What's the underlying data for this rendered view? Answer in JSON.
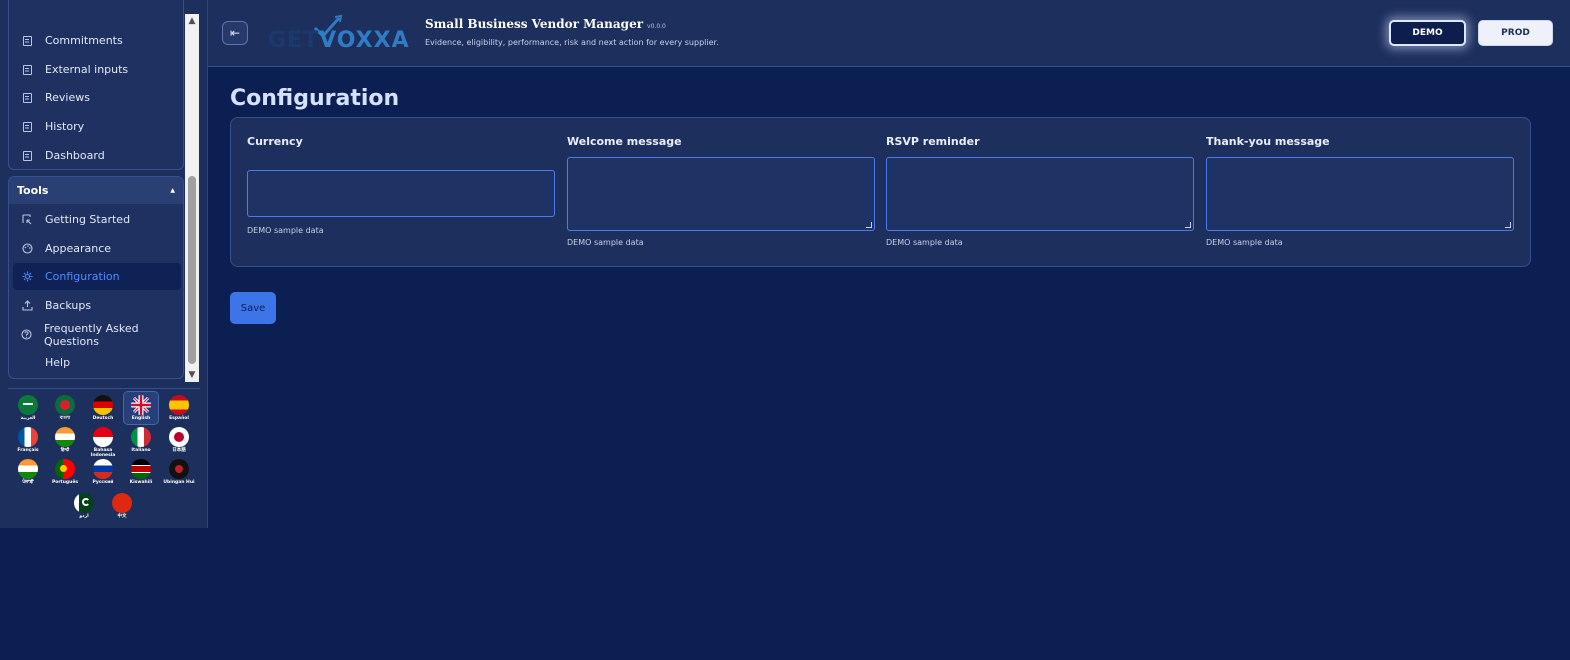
{
  "sidebar": {
    "items_top": [
      {
        "label": "Commitments"
      },
      {
        "label": "External inputs"
      },
      {
        "label": "Reviews"
      },
      {
        "label": "History"
      },
      {
        "label": "Dashboard"
      }
    ],
    "tools": {
      "title": "Tools",
      "chevron": "▲",
      "items": [
        {
          "label": "Getting Started",
          "icon": "getting-started-icon"
        },
        {
          "label": "Appearance",
          "icon": "palette-icon"
        },
        {
          "label": "Configuration",
          "icon": "gear-icon",
          "active": true
        },
        {
          "label": "Backups",
          "icon": "upload-icon"
        },
        {
          "label": "Frequently Asked Questions",
          "icon": "help-circle-icon"
        },
        {
          "label": "Help",
          "icon": ""
        }
      ]
    },
    "languages": [
      {
        "label": "العربية"
      },
      {
        "label": "বাংলা"
      },
      {
        "label": "Deutsch"
      },
      {
        "label": "English",
        "selected": true
      },
      {
        "label": "Español"
      },
      {
        "label": "Français"
      },
      {
        "label": "हिन्दी"
      },
      {
        "label": "Bahasa Indonesia"
      },
      {
        "label": "Italiano"
      },
      {
        "label": "日本語"
      },
      {
        "label": "ਪੰਜਾਬੀ"
      },
      {
        "label": "Português"
      },
      {
        "label": "Русский"
      },
      {
        "label": "Kiswahili"
      },
      {
        "label": "Ubingan Hui"
      },
      {
        "label": "اردو"
      },
      {
        "label": "中文"
      }
    ]
  },
  "header": {
    "toggle_icon": "⇤",
    "logo_get": "GET",
    "logo_voxxa": "VOXXA",
    "title": "Small Business Vendor Manager",
    "version": "v0.0.0",
    "subtitle": "Evidence, eligibility, performance, risk and next action for every supplier.",
    "demo_label": "DEMO",
    "prod_label": "PROD"
  },
  "main": {
    "title": "Configuration",
    "fields": [
      {
        "label": "Currency",
        "value": "",
        "hint": "DEMO sample data"
      },
      {
        "label": "Welcome message",
        "value": "",
        "hint": "DEMO sample data"
      },
      {
        "label": "RSVP reminder",
        "value": "",
        "hint": "DEMO sample data"
      },
      {
        "label": "Thank-you message",
        "value": "",
        "hint": "DEMO sample data"
      }
    ],
    "save_label": "Save"
  },
  "colors": {
    "background": "#0c1f52",
    "panel": "#1d2f5c",
    "accent": "#3d74e8",
    "active_text": "#4f8cff"
  }
}
